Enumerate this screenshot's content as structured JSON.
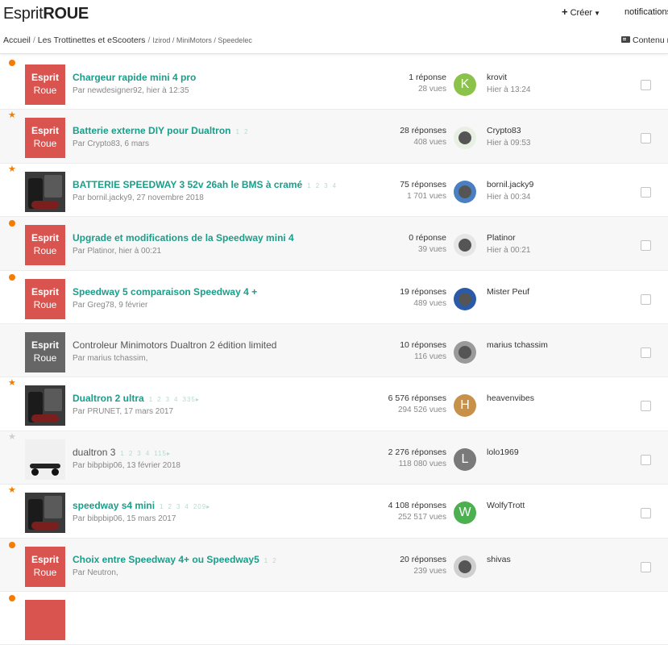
{
  "header": {
    "logo_regular": "Esprit",
    "logo_bold": "ROUE",
    "create_label": "Créer",
    "notifications_label": "notifications"
  },
  "breadcrumb": {
    "items": [
      "Accueil",
      "Les Trottinettes et eScooters",
      "Izirod / MiniMotors / Speedelec"
    ]
  },
  "content_link": "Contenu r",
  "topics": [
    {
      "marker": "dot",
      "thumb": "red",
      "thumb_l1": "Esprit",
      "thumb_l2": "Roue",
      "title": "Chargeur rapide mini 4 pro",
      "unread": true,
      "pages": [],
      "meta": "Par newdesigner92, hier à 12:35",
      "replies": "1 réponse",
      "views": "28 vues",
      "avatar_letter": "K",
      "avatar_color": "#8bc34a",
      "last_user": "krovit",
      "last_date": "Hier à 13:24"
    },
    {
      "marker": "star",
      "thumb": "red",
      "thumb_l1": "Esprit",
      "thumb_l2": "Roue",
      "title": "Batterie externe DIY pour Dualtron",
      "unread": true,
      "pages": [
        "1",
        "2"
      ],
      "meta": "Par Crypto83, 6 mars",
      "replies": "28 réponses",
      "views": "408 vues",
      "avatar_letter": "",
      "avatar_color": "#e8f0e4",
      "last_user": "Crypto83",
      "last_date": "Hier à 09:53"
    },
    {
      "marker": "star",
      "thumb": "photo",
      "thumb_l1": "",
      "thumb_l2": "",
      "title": "BATTERIE SPEEDWAY 3 52v 26ah le BMS à cramé",
      "unread": true,
      "pages": [
        "1",
        "2",
        "3",
        "4"
      ],
      "meta": "Par bornil.jacky9, 27 novembre 2018",
      "replies": "75 réponses",
      "views": "1 701 vues",
      "avatar_letter": "",
      "avatar_color": "#4a7fc1",
      "last_user": "bornil.jacky9",
      "last_date": "Hier à 00:34"
    },
    {
      "marker": "dot",
      "thumb": "red",
      "thumb_l1": "Esprit",
      "thumb_l2": "Roue",
      "title": "Upgrade et modifications de la Speedway mini 4",
      "unread": true,
      "pages": [],
      "meta": "Par Platinor, hier à 00:21",
      "replies": "0 réponse",
      "views": "39 vues",
      "avatar_letter": "",
      "avatar_color": "#e6e6e6",
      "last_user": "Platinor",
      "last_date": "Hier à 00:21"
    },
    {
      "marker": "dot",
      "thumb": "red",
      "thumb_l1": "Esprit",
      "thumb_l2": "Roue",
      "title": "Speedway 5 comparaison Speedway 4 +",
      "unread": true,
      "pages": [],
      "meta": "Par Greg78, 9 février",
      "replies": "19 réponses",
      "views": "489 vues",
      "avatar_letter": "",
      "avatar_color": "#2a5aa8",
      "last_user": "Mister Peuf",
      "last_date": ""
    },
    {
      "marker": "none",
      "thumb": "grey",
      "thumb_l1": "Esprit",
      "thumb_l2": "Roue",
      "title": "Controleur Minimotors Dualtron 2 édition limited",
      "unread": false,
      "pages": [],
      "meta": "Par marius tchassim,",
      "replies": "10 réponses",
      "views": "116 vues",
      "avatar_letter": "",
      "avatar_color": "#9a9a9a",
      "last_user": "marius tchassim",
      "last_date": ""
    },
    {
      "marker": "star",
      "thumb": "photo",
      "thumb_l1": "",
      "thumb_l2": "",
      "title": "Dualtron 2 ultra",
      "unread": true,
      "pages": [
        "1",
        "2",
        "3",
        "4",
        "335▸"
      ],
      "meta": "Par PRUNET, 17 mars 2017",
      "replies": "6 576 réponses",
      "views": "294 526 vues",
      "avatar_letter": "H",
      "avatar_color": "#c8914a",
      "last_user": "heavenvibes",
      "last_date": ""
    },
    {
      "marker": "star-grey",
      "thumb": "photo-light",
      "thumb_l1": "",
      "thumb_l2": "",
      "title": "dualtron 3",
      "unread": false,
      "pages": [
        "1",
        "2",
        "3",
        "4",
        "115▸"
      ],
      "meta": "Par bibpbip06, 13 février 2018",
      "replies": "2 276 réponses",
      "views": "118 080 vues",
      "avatar_letter": "L",
      "avatar_color": "#7a7a7a",
      "last_user": "lolo1969",
      "last_date": ""
    },
    {
      "marker": "star",
      "thumb": "photo",
      "thumb_l1": "",
      "thumb_l2": "",
      "title": "speedway s4 mini",
      "unread": true,
      "pages": [
        "1",
        "2",
        "3",
        "4",
        "209▸"
      ],
      "meta": "Par bibpbip06, 15 mars 2017",
      "replies": "4 108 réponses",
      "views": "252 517 vues",
      "avatar_letter": "W",
      "avatar_color": "#4caf50",
      "last_user": "WolfyTrott",
      "last_date": ""
    },
    {
      "marker": "dot",
      "thumb": "red",
      "thumb_l1": "Esprit",
      "thumb_l2": "Roue",
      "title": "Choix entre Speedway 4+ ou Speedway5",
      "unread": true,
      "pages": [
        "1",
        "2"
      ],
      "meta": "Par Neutron,",
      "replies": "20 réponses",
      "views": "239 vues",
      "avatar_letter": "",
      "avatar_color": "#cfcfcf",
      "last_user": "shivas",
      "last_date": ""
    },
    {
      "marker": "dot",
      "thumb": "red",
      "thumb_l1": "",
      "thumb_l2": "",
      "title": "",
      "unread": true,
      "pages": [],
      "meta": "",
      "replies": "",
      "views": "",
      "avatar_letter": "",
      "avatar_color": "#ffffff",
      "last_user": "",
      "last_date": ""
    }
  ]
}
